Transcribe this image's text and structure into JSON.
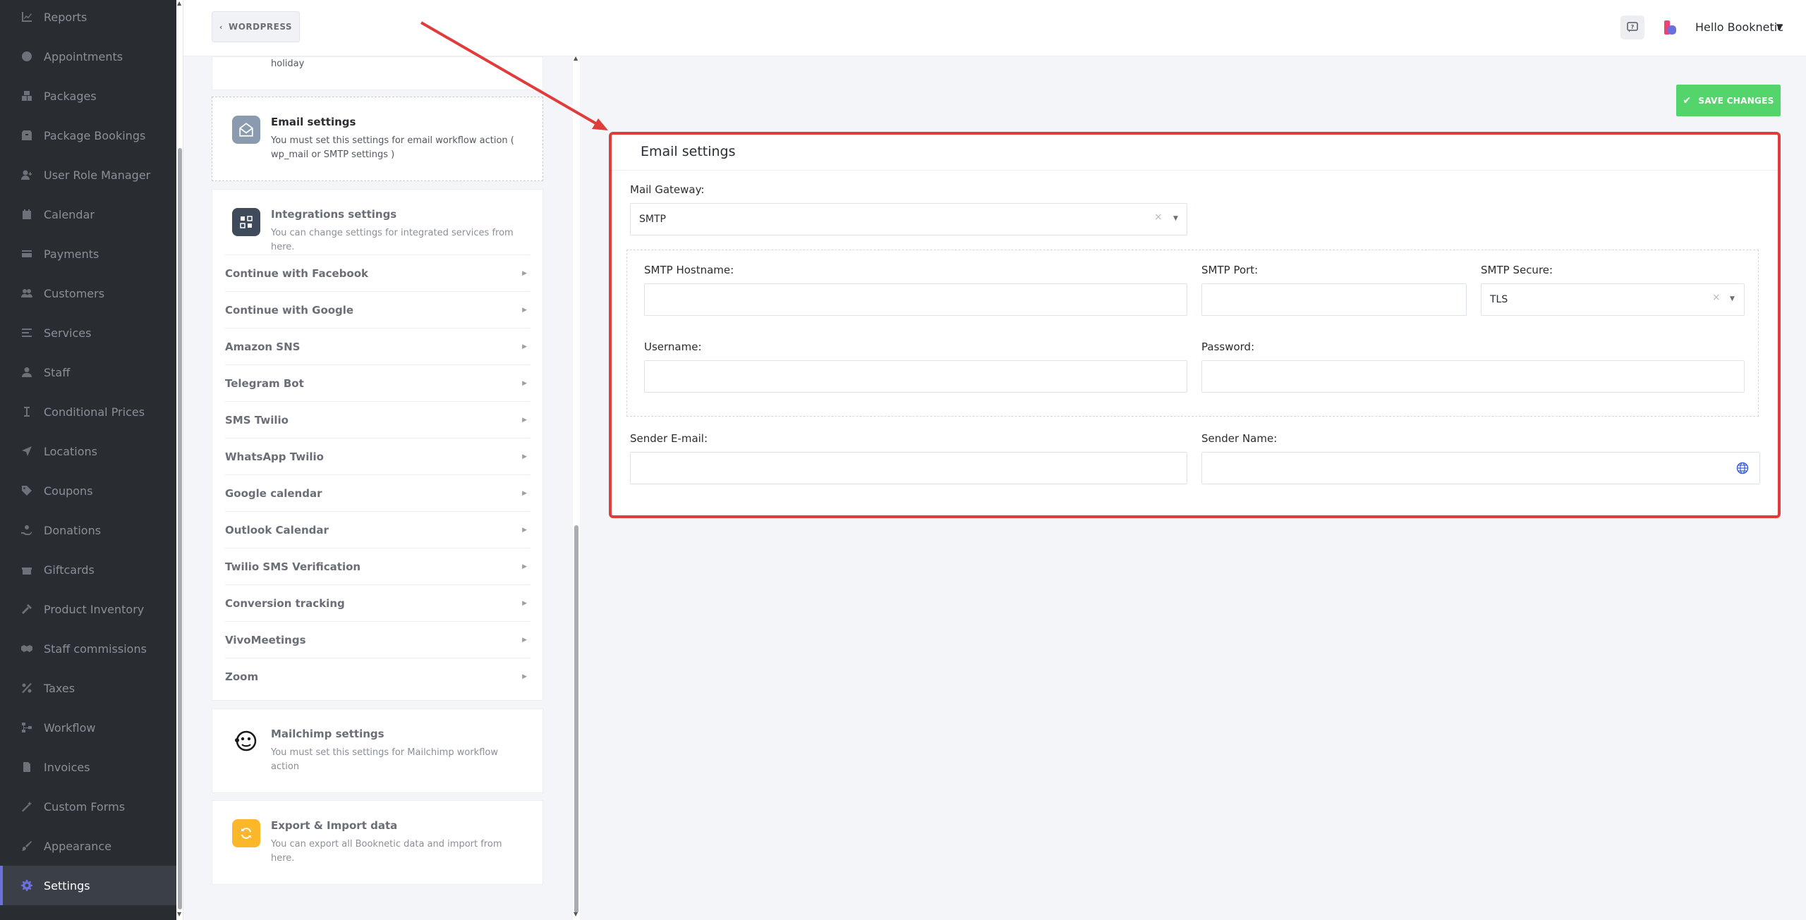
{
  "sidebar": {
    "items": [
      {
        "label": "Reports",
        "icon": "chart-line-icon"
      },
      {
        "label": "Appointments",
        "icon": "clock-icon"
      },
      {
        "label": "Packages",
        "icon": "boxes-icon"
      },
      {
        "label": "Package Bookings",
        "icon": "box-icon"
      },
      {
        "label": "User Role Manager",
        "icon": "user-plus-icon"
      },
      {
        "label": "Calendar",
        "icon": "calendar-icon"
      },
      {
        "label": "Payments",
        "icon": "credit-card-icon"
      },
      {
        "label": "Customers",
        "icon": "users-icon"
      },
      {
        "label": "Services",
        "icon": "list-icon"
      },
      {
        "label": "Staff",
        "icon": "user-icon"
      },
      {
        "label": "Conditional Prices",
        "icon": "i-cursor-icon"
      },
      {
        "label": "Locations",
        "icon": "location-arrow-icon"
      },
      {
        "label": "Coupons",
        "icon": "tags-icon"
      },
      {
        "label": "Donations",
        "icon": "hand-holding-icon"
      },
      {
        "label": "Giftcards",
        "icon": "gift-icon"
      },
      {
        "label": "Product Inventory",
        "icon": "tools-icon"
      },
      {
        "label": "Staff commissions",
        "icon": "handshake-icon"
      },
      {
        "label": "Taxes",
        "icon": "percent-icon"
      },
      {
        "label": "Workflow",
        "icon": "workflow-icon"
      },
      {
        "label": "Invoices",
        "icon": "file-invoice-icon"
      },
      {
        "label": "Custom Forms",
        "icon": "magic-wand-icon"
      },
      {
        "label": "Appearance",
        "icon": "paint-brush-icon"
      },
      {
        "label": "Settings",
        "icon": "cog-icon"
      }
    ],
    "active": "Settings"
  },
  "topbar": {
    "back_label": "WORDPRESS",
    "greeting": "Hello Booknetic"
  },
  "settings_list": {
    "holiday_text": "holiday",
    "email_card": {
      "title": "Email settings",
      "desc": "You must set this settings for email workflow action ( wp_mail or SMTP settings )"
    },
    "integrations_card": {
      "title": "Integrations settings",
      "desc": "You can change settings for integrated services from here.",
      "items": [
        "Continue with Facebook",
        "Continue with Google",
        "Amazon SNS",
        "Telegram Bot",
        "SMS Twilio",
        "WhatsApp Twilio",
        "Google calendar",
        "Outlook Calendar",
        "Twilio SMS Verification",
        "Conversion tracking",
        "VivoMeetings",
        "Zoom"
      ]
    },
    "mailchimp_card": {
      "title": "Mailchimp settings",
      "desc": "You must set this settings for Mailchimp workflow action"
    },
    "export_card": {
      "title": "Export & Import data",
      "desc": "You can export all Booknetic data and import from here."
    }
  },
  "main": {
    "save_label": "SAVE CHANGES",
    "form_title": "Email settings",
    "fields": {
      "mail_gateway": {
        "label": "Mail Gateway:",
        "value": "SMTP"
      },
      "smtp_hostname": {
        "label": "SMTP Hostname:",
        "value": ""
      },
      "smtp_port": {
        "label": "SMTP Port:",
        "value": ""
      },
      "smtp_secure": {
        "label": "SMTP Secure:",
        "value": "TLS"
      },
      "username": {
        "label": "Username:",
        "value": ""
      },
      "password": {
        "label": "Password:",
        "value": ""
      },
      "sender_email": {
        "label": "Sender E-mail:",
        "value": ""
      },
      "sender_name": {
        "label": "Sender Name:",
        "value": ""
      }
    }
  },
  "colors": {
    "sidebar_bg": "#292d32",
    "accent": "#6c70dc",
    "save_green": "#53d56c",
    "annotation_red": "#e03c3c"
  }
}
